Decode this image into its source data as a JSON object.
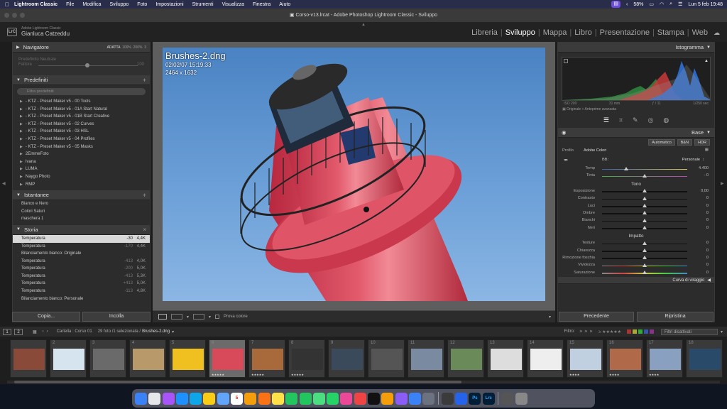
{
  "menubar": {
    "app": "Lightroom Classic",
    "items": [
      "File",
      "Modifica",
      "Sviluppo",
      "Foto",
      "Impostazioni",
      "Strumenti",
      "Visualizza",
      "Finestra",
      "Aiuto"
    ],
    "battery": "58%",
    "datetime": "Lun 5 feb  19:48"
  },
  "window": {
    "title": "Corso-v13.lrcat - Adobe Photoshop Lightroom Classic - Sviluppo"
  },
  "identity": {
    "logo": "LrC",
    "product": "Adobe Lightroom Classic",
    "user": "Gianluca Catzeddu"
  },
  "modules": [
    "Libreria",
    "Sviluppo",
    "Mappa",
    "Libro",
    "Presentazione",
    "Stampa",
    "Web"
  ],
  "active_module": "Sviluppo",
  "navigator": {
    "title": "Navigatore",
    "zoom_options": [
      "ADATTA",
      "100%",
      "200%",
      "3"
    ],
    "preset_preview": "Predefinito Neutrale",
    "fill_label": "Fattore",
    "fill_value": "100"
  },
  "presets": {
    "title": "Predefiniti",
    "search_placeholder": "Filtra predefiniti",
    "items": [
      "- KTZ - Preset Maker v5 - 00 Tools",
      "- KTZ - Preset Maker v5 - 01A Start Natural",
      "- KTZ - Preset Maker v5 - 01B Start Creative",
      "- KTZ - Preset Maker v5 - 02 Curves",
      "- KTZ - Preset Maker v5 - 03 HSL",
      "- KTZ - Preset Maker v5 - 04 Profiles",
      "- KTZ - Preset Maker v5 - 05 Masks",
      "2EmmeFoto",
      "Ivana",
      "LUMA",
      "Naygo Photo",
      "RMP"
    ]
  },
  "snapshots": {
    "title": "Istantanee",
    "items": [
      "Bianco e Nero",
      "Colori Saturi",
      "maschera 1"
    ]
  },
  "history": {
    "title": "Storia",
    "items": [
      {
        "label": "Temperatura",
        "v1": "-30",
        "v2": "4,4K",
        "selected": true
      },
      {
        "label": "Temperatura",
        "v1": "-170",
        "v2": "4,4K",
        "selected": false
      },
      {
        "label": "Bilanciamento bianco: Originale",
        "v1": "",
        "v2": "",
        "selected": false
      },
      {
        "label": "Temperatura",
        "v1": "-413",
        "v2": "4,0K",
        "selected": false
      },
      {
        "label": "Temperatura",
        "v1": "-200",
        "v2": "5,0K",
        "selected": false
      },
      {
        "label": "Temperatura",
        "v1": "-413",
        "v2": "5,3K",
        "selected": false
      },
      {
        "label": "Temperatura",
        "v1": "+413",
        "v2": "5,0K",
        "selected": false
      },
      {
        "label": "Temperatura",
        "v1": "-113",
        "v2": "4,8K",
        "selected": false
      },
      {
        "label": "Bilanciamento bianco: Personale",
        "v1": "",
        "v2": "",
        "selected": false
      }
    ]
  },
  "left_buttons": {
    "copy": "Copia...",
    "paste": "Incolla"
  },
  "photo": {
    "filename": "Brushes-2.dng",
    "datetime": "02/02/07 15:19:33",
    "dimensions": "2464 x 1632"
  },
  "toolbar": {
    "soft_proof": "Prova colore"
  },
  "histogram_panel": {
    "title": "Istogramma",
    "iso": "ISO 200",
    "focal": "31 mm",
    "aperture": "ƒ / 11",
    "shutter": "1/250 sec",
    "original_label": "Originale + Anteprime avanzata"
  },
  "basic": {
    "title": "Base",
    "treatments": [
      "Automatico",
      "B&N",
      "HDR"
    ],
    "profile_label": "Profilo",
    "profile_value": "Adobe Colori",
    "wb_label": "BB:",
    "wb_value": "Personale",
    "wb_sliders": [
      {
        "label": "Temp",
        "value": "4.400",
        "pos": 0.28
      },
      {
        "label": "Tinta",
        "value": "- 0",
        "pos": 0.5
      }
    ],
    "tone_label": "Tono",
    "tone_sliders": [
      {
        "label": "Esposizione",
        "value": "0,00",
        "pos": 0.5
      },
      {
        "label": "Contrasto",
        "value": "0",
        "pos": 0.5
      },
      {
        "label": "Luci",
        "value": "0",
        "pos": 0.5
      },
      {
        "label": "Ombre",
        "value": "0",
        "pos": 0.5
      },
      {
        "label": "Bianchi",
        "value": "0",
        "pos": 0.5
      },
      {
        "label": "Neri",
        "value": "0",
        "pos": 0.5
      }
    ],
    "presence_label": "Impatto",
    "presence_sliders": [
      {
        "label": "Texture",
        "value": "0",
        "pos": 0.5
      },
      {
        "label": "Chiarezza",
        "value": "0",
        "pos": 0.5
      },
      {
        "label": "Rimozione foschia",
        "value": "0",
        "pos": 0.5
      },
      {
        "label": "Vividezza",
        "value": "0",
        "pos": 0.5
      },
      {
        "label": "Saturazione",
        "value": "0",
        "pos": 0.5
      }
    ],
    "next_section": "Curva di viraggio"
  },
  "right_buttons": {
    "previous": "Precedente",
    "reset": "Ripristina"
  },
  "filmbar": {
    "views": [
      "1",
      "2"
    ],
    "source": "Cartella : Corso 01",
    "count": "29 foto /1 selezionata /",
    "selected_file": "Brushes-2.dng",
    "filter_label": "Filtro:",
    "filter_value": "Filtri disattivati"
  },
  "filmstrip": [
    {
      "num": "",
      "stars": ""
    },
    {
      "num": "2",
      "stars": ""
    },
    {
      "num": "3",
      "stars": ""
    },
    {
      "num": "4",
      "stars": ""
    },
    {
      "num": "5",
      "stars": ""
    },
    {
      "num": "6",
      "stars": "★★★★★"
    },
    {
      "num": "7",
      "stars": "★★★★★"
    },
    {
      "num": "8",
      "stars": "★★★★★"
    },
    {
      "num": "9",
      "stars": ""
    },
    {
      "num": "10",
      "stars": ""
    },
    {
      "num": "11",
      "stars": ""
    },
    {
      "num": "12",
      "stars": ""
    },
    {
      "num": "13",
      "stars": ""
    },
    {
      "num": "14",
      "stars": ""
    },
    {
      "num": "15",
      "stars": "★★★★"
    },
    {
      "num": "16",
      "stars": "★★★★"
    },
    {
      "num": "17",
      "stars": "★★★★"
    },
    {
      "num": "18",
      "stars": ""
    }
  ],
  "dock": {
    "apps": [
      "finder",
      "launchpad",
      "safari",
      "app-store-like",
      "chrome",
      "photos",
      "mail",
      "calendar",
      "contacts",
      "reminders",
      "notes",
      "facetime",
      "messages",
      "maps",
      "whatsapp",
      "photos2",
      "music",
      "tv",
      "freeform",
      "podcasts",
      "appstore2",
      "settings",
      "nav",
      "zoom",
      "photoshop",
      "lightroom"
    ],
    "labels": {
      "photoshop": "Ps",
      "lightroom": "Lrc",
      "calendar": "5"
    }
  },
  "colors": {
    "accent": "#6b4dd8",
    "photo_sky": "#5e95d1",
    "lighthouse_red": "#d8455a"
  }
}
